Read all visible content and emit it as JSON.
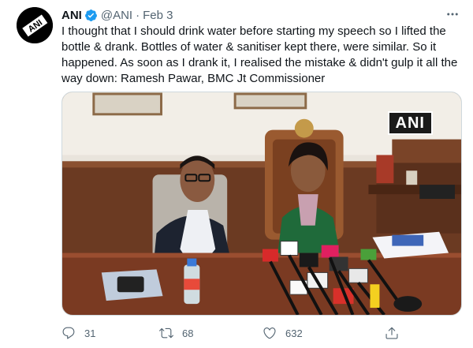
{
  "tweet": {
    "author_name": "ANI",
    "handle": "@ANI",
    "separator": "·",
    "date": "Feb 3",
    "text": "I thought that I should drink water before starting my speech so I lifted the bottle & drank. Bottles of water & sanitiser kept there, were similar. So it happened. As soon as I drank it, I realised the mistake & didn't gulp it all the way down: Ramesh Pawar, BMC Jt Commissioner",
    "avatar_logo_text": "ANI",
    "media": {
      "watermark": "ANI"
    },
    "actions": {
      "replies": "31",
      "retweets": "68",
      "likes": "632"
    }
  },
  "colors": {
    "text_primary": "#0f1419",
    "text_secondary": "#536471",
    "verified_blue": "#1d9bf0",
    "border": "#cfd9de"
  },
  "icons": {
    "verified": "verified-badge-icon",
    "more": "more-horizontal-icon",
    "reply": "reply-icon",
    "retweet": "retweet-icon",
    "like": "heart-icon",
    "share": "share-icon"
  }
}
